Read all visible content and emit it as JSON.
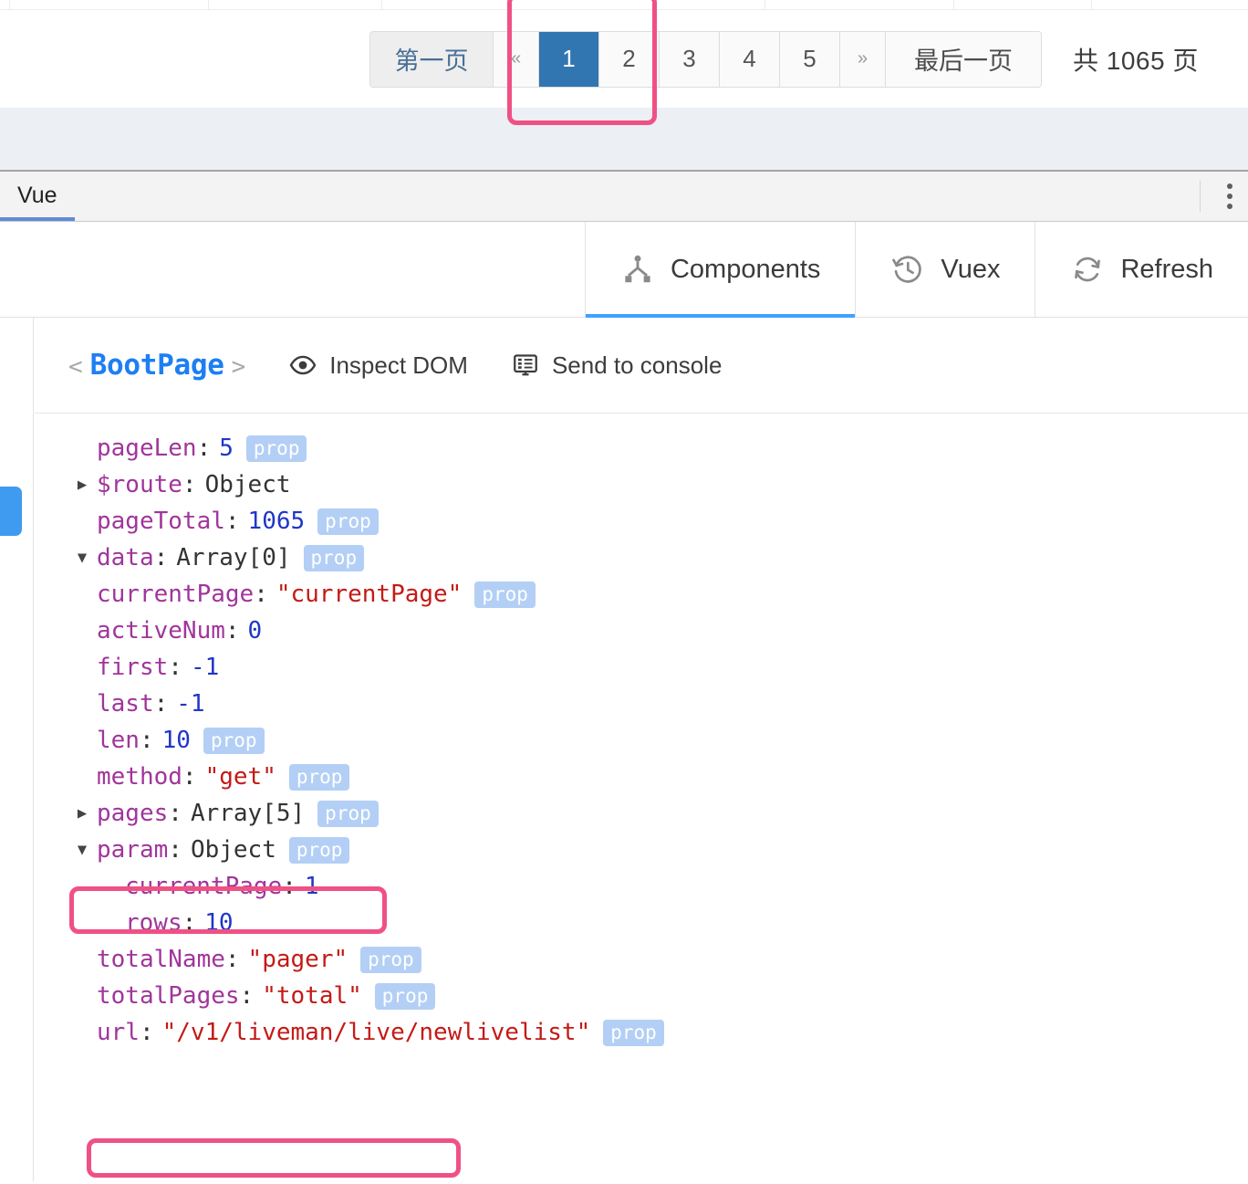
{
  "app": {
    "pagination": {
      "first_label": "第一页",
      "prev_label": "«",
      "pages": [
        "1",
        "2",
        "3",
        "4",
        "5"
      ],
      "active_page": "1",
      "next_label": "»",
      "last_label": "最后一页",
      "total_label": "共 1065 页",
      "active_color": "#3276b1"
    },
    "table_dividers": [
      10,
      228,
      418,
      838,
      1045,
      1196
    ]
  },
  "devtools": {
    "tabs": [
      {
        "label": "Vue",
        "active": true
      }
    ],
    "menu_icon": "kebab-menu-icon",
    "toolbar_tabs": [
      {
        "label": "Components",
        "icon": "component-tree-icon",
        "active": true
      },
      {
        "label": "Vuex",
        "icon": "clock-history-icon",
        "active": false
      },
      {
        "label": "Refresh",
        "icon": "refresh-icon",
        "active": false
      }
    ],
    "inspector": {
      "open_angle": "<",
      "component_name": "BootPage",
      "close_angle": ">",
      "inspect_dom_label": "Inspect DOM",
      "inspect_dom_icon": "eye-icon",
      "send_console_label": "Send to console",
      "send_console_icon": "console-icon",
      "props": [
        {
          "twisty": "",
          "indent": 1,
          "key": "pageLen",
          "value": "5",
          "value_type": "num",
          "badge": "prop"
        },
        {
          "twisty": "▶",
          "indent": 1,
          "key": "$route",
          "value": "Object",
          "value_type": "obj",
          "badge": ""
        },
        {
          "twisty": "",
          "indent": 1,
          "key": "pageTotal",
          "value": "1065",
          "value_type": "num",
          "badge": "prop"
        },
        {
          "twisty": "▼",
          "indent": 1,
          "key": "data",
          "value": "Array[0]",
          "value_type": "obj",
          "badge": "prop"
        },
        {
          "twisty": "",
          "indent": 1,
          "key": "currentPage",
          "value": "\"currentPage\"",
          "value_type": "str",
          "badge": "prop"
        },
        {
          "twisty": "",
          "indent": 1,
          "key": "activeNum",
          "value": "0",
          "value_type": "num",
          "badge": ""
        },
        {
          "twisty": "",
          "indent": 1,
          "key": "first",
          "value": "-1",
          "value_type": "num",
          "badge": ""
        },
        {
          "twisty": "",
          "indent": 1,
          "key": "last",
          "value": "-1",
          "value_type": "num",
          "badge": ""
        },
        {
          "twisty": "",
          "indent": 1,
          "key": "len",
          "value": "10",
          "value_type": "num",
          "badge": "prop"
        },
        {
          "twisty": "",
          "indent": 1,
          "key": "method",
          "value": "\"get\"",
          "value_type": "str",
          "badge": "prop"
        },
        {
          "twisty": "▶",
          "indent": 1,
          "key": "pages",
          "value": "Array[5]",
          "value_type": "obj",
          "badge": "prop"
        },
        {
          "twisty": "▼",
          "indent": 1,
          "key": "param",
          "value": "Object",
          "value_type": "obj",
          "badge": "prop"
        },
        {
          "twisty": "",
          "indent": 2,
          "key": "currentPage",
          "value": "1",
          "value_type": "num",
          "badge": ""
        },
        {
          "twisty": "",
          "indent": 2,
          "key": "rows",
          "value": "10",
          "value_type": "num",
          "badge": ""
        },
        {
          "twisty": "",
          "indent": 1,
          "key": "totalName",
          "value": "\"pager\"",
          "value_type": "str",
          "badge": "prop"
        },
        {
          "twisty": "",
          "indent": 1,
          "key": "totalPages",
          "value": "\"total\"",
          "value_type": "str",
          "badge": "prop"
        },
        {
          "twisty": "",
          "indent": 1,
          "key": "url",
          "value": "\"/v1/liveman/live/newlivelist\"",
          "value_type": "str",
          "badge": "prop"
        }
      ]
    }
  },
  "annotations": {
    "color": "#ef5184",
    "boxes": [
      "pagination-page-one",
      "activeNum-row",
      "param-currentPage-row"
    ]
  }
}
